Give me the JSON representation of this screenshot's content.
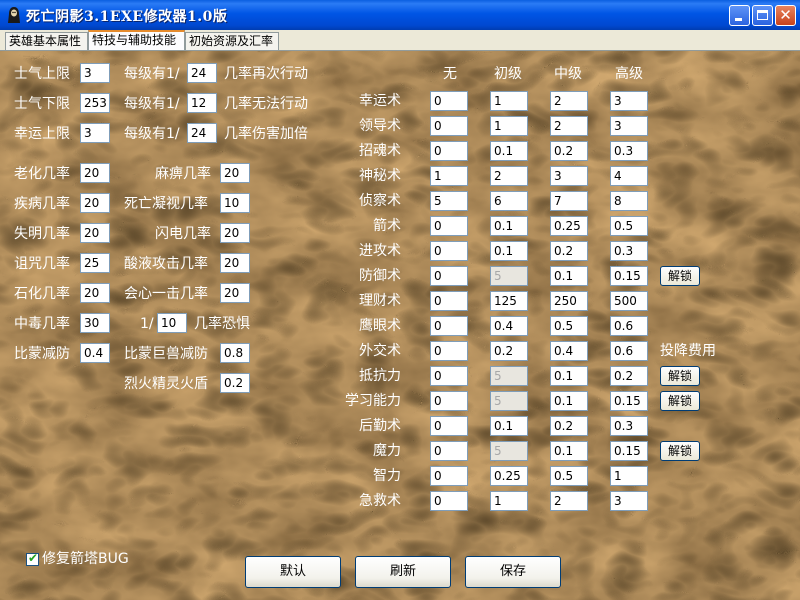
{
  "window": {
    "title": "死亡阴影3.1EXE修改器1.0版"
  },
  "tabs": [
    {
      "label": "英雄基本属性",
      "active": false
    },
    {
      "label": "特技与辅助技能",
      "active": true
    },
    {
      "label": "初始资源及汇率",
      "active": false
    }
  ],
  "left": {
    "morale_max": {
      "label": "士气上限",
      "value": "3"
    },
    "morale_min": {
      "label": "士气下限",
      "value": "253"
    },
    "luck_max": {
      "label": "幸运上限",
      "value": "3"
    },
    "per_level_prefix": "每级有1/",
    "chance_extra_action": {
      "value": "24",
      "suffix": "几率再次行动"
    },
    "chance_no_action": {
      "value": "12",
      "suffix": "几率无法行动"
    },
    "chance_double_damage": {
      "value": "24",
      "suffix": "几率伤害加倍"
    },
    "aging": {
      "label": "老化几率",
      "value": "20"
    },
    "disease": {
      "label": "疾病几率",
      "value": "20"
    },
    "blind": {
      "label": "失明几率",
      "value": "20"
    },
    "curse": {
      "label": "诅咒几率",
      "value": "25"
    },
    "petrify": {
      "label": "石化几率",
      "value": "20"
    },
    "poison": {
      "label": "中毒几率",
      "value": "30"
    },
    "paralyze": {
      "label": "麻痹几率",
      "value": "20"
    },
    "death_stare": {
      "label": "死亡凝视几率",
      "value": "10"
    },
    "lightning": {
      "label": "闪电几率",
      "value": "20"
    },
    "acid": {
      "label": "酸液攻击几率",
      "value": "20"
    },
    "critical": {
      "label": "会心一击几率",
      "value": "20"
    },
    "fear": {
      "prefix": "1/",
      "value": "10",
      "suffix": "几率恐惧"
    },
    "behemoth_def": {
      "label": "比蒙减防",
      "value": "0.4"
    },
    "ancient_behemoth_def": {
      "label": "比蒙巨兽减防",
      "value": "0.8"
    },
    "firebird_shield": {
      "label": "烈火精灵火盾",
      "value": "0.2"
    }
  },
  "skills": {
    "headers": [
      "无",
      "初级",
      "中级",
      "高级"
    ],
    "rows": [
      {
        "name": "幸运术",
        "values": [
          "0",
          "1",
          "2",
          "3"
        ]
      },
      {
        "name": "领导术",
        "values": [
          "0",
          "1",
          "2",
          "3"
        ]
      },
      {
        "name": "招魂术",
        "values": [
          "0",
          "0.1",
          "0.2",
          "0.3"
        ]
      },
      {
        "name": "神秘术",
        "values": [
          "1",
          "2",
          "3",
          "4"
        ]
      },
      {
        "name": "侦察术",
        "values": [
          "5",
          "6",
          "7",
          "8"
        ]
      },
      {
        "name": "箭术",
        "values": [
          "0",
          "0.1",
          "0.25",
          "0.5"
        ]
      },
      {
        "name": "进攻术",
        "values": [
          "0",
          "0.1",
          "0.2",
          "0.3"
        ]
      },
      {
        "name": "防御术",
        "values": [
          "0",
          "5",
          "0.1",
          "0.15"
        ],
        "disabled_basic": true,
        "extra": "解锁"
      },
      {
        "name": "理财术",
        "values": [
          "0",
          "125",
          "250",
          "500"
        ]
      },
      {
        "name": "鹰眼术",
        "values": [
          "0",
          "0.4",
          "0.5",
          "0.6"
        ]
      },
      {
        "name": "外交术",
        "values": [
          "0",
          "0.2",
          "0.4",
          "0.6"
        ],
        "note": "投降费用"
      },
      {
        "name": "抵抗力",
        "values": [
          "0",
          "5",
          "0.1",
          "0.2"
        ],
        "disabled_basic": true,
        "extra": "解锁"
      },
      {
        "name": "学习能力",
        "values": [
          "0",
          "5",
          "0.1",
          "0.15"
        ],
        "disabled_basic": true,
        "extra": "解锁"
      },
      {
        "name": "后勤术",
        "values": [
          "0",
          "0.1",
          "0.2",
          "0.3"
        ]
      },
      {
        "name": "魔力",
        "values": [
          "0",
          "5",
          "0.1",
          "0.15"
        ],
        "disabled_basic": true,
        "extra": "解锁"
      },
      {
        "name": "智力",
        "values": [
          "0",
          "0.25",
          "0.5",
          "1"
        ]
      },
      {
        "name": "急救术",
        "values": [
          "0",
          "1",
          "2",
          "3"
        ]
      }
    ]
  },
  "footer": {
    "fix_bug": {
      "label": "修复箭塔BUG",
      "checked": true
    },
    "buttons": {
      "default": "默认",
      "refresh": "刷新",
      "save": "保存"
    }
  }
}
